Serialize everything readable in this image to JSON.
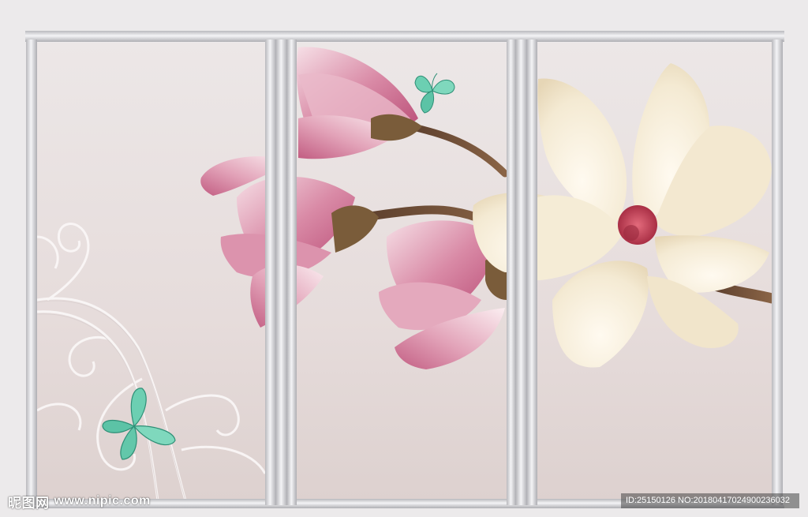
{
  "scene": {
    "subject": "magnolia-triptych-wall-mural",
    "panels": 3,
    "colors": {
      "background": "#ece6e5",
      "frame": "#c9c9cc",
      "bud_pink": "#c85e86",
      "bloom_cream": "#f6ecd8",
      "stamen_red": "#c23a4e",
      "butterfly_green": "#4fbf9a"
    }
  },
  "watermark": {
    "brand": "昵图网",
    "url": "www.nipic.com",
    "id_text": "ID:25150126 NO:20180417024900236032"
  }
}
